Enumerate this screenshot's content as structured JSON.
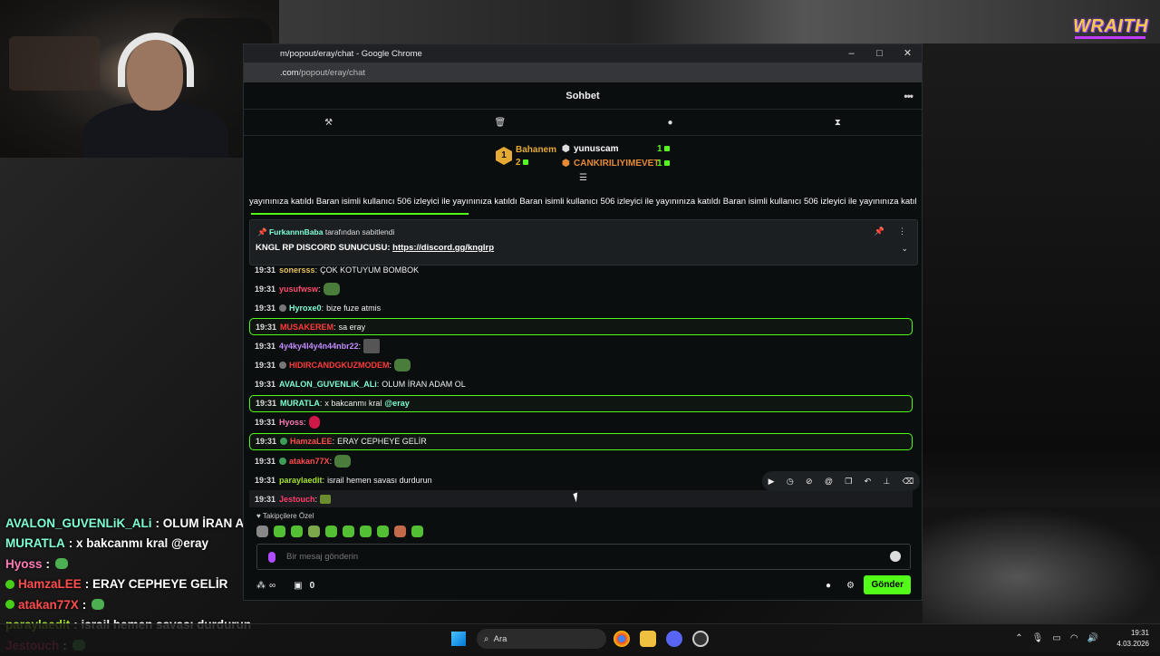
{
  "brand": "WRAITH",
  "overlay_chat": [
    {
      "user": "AVALON_GUVENLiK_ALi",
      "text": ": OLUM İRAN ADAM OL",
      "color": "#7fffd4",
      "badge": false,
      "emote": false
    },
    {
      "user": "MURATLA",
      "text": ": x bakcanmı kral @eray",
      "color": "#7fffd4",
      "badge": false,
      "emote": false
    },
    {
      "user": "Hyoss",
      "text": ":",
      "color": "#ff7ab6",
      "badge": false,
      "emote": true
    },
    {
      "user": "HamzaLEE",
      "text": ": ERAY CEPHEYE GELİR",
      "color": "#ff4d4d",
      "badge": true,
      "emote": false
    },
    {
      "user": "atakan77X",
      "text": ":",
      "color": "#ff4d4d",
      "badge": true,
      "emote": true
    },
    {
      "user": "paraylaedit",
      "text": ": israil hemen savası durdurun",
      "color": "#a6e22e",
      "badge": false,
      "emote": false
    },
    {
      "user": "Jestouch",
      "text": ":",
      "color": "#ff3b6b",
      "badge": false,
      "emote": true
    }
  ],
  "window": {
    "title": "m/popout/eray/chat - Google Chrome",
    "url_host": ".com",
    "url_path": "/popout/eray/chat"
  },
  "chat": {
    "title": "Sohbet",
    "leaderboard": {
      "first": {
        "name": "Bahanem",
        "rank": "1",
        "count": "2"
      },
      "second": {
        "name": "yunuscam",
        "count": "1"
      },
      "third": {
        "name": "CANKIRILIYIMEVET",
        "count": "1"
      }
    },
    "ticker": "yayınınıza katıldı   Baran isimli kullanıcı 506 izleyici ile yayınınıza katıldı   Baran isimli kullanıcı 506 izleyici ile yayınınıza katıldı   Baran isimli kullanıcı 506 izleyici ile yayınınıza katıl",
    "pinned": {
      "by_user": "FurkannnBaba",
      "by_text": "tarafından sabitlendi",
      "prefix": "KNGL RP DISCORD SUNUCUSU: ",
      "link": "https://discord.gg/knglrp"
    },
    "messages": [
      {
        "time": "19:31",
        "user": "sonersss",
        "color": "#e6c15a",
        "text": "ÇOK KÖTÜYÜM BOMBOK",
        "hl": false
      },
      {
        "time": "19:31",
        "user": "yusufwsw",
        "color": "#ff4d6d",
        "text": "",
        "emote": "em",
        "hl": false
      },
      {
        "time": "19:31",
        "user": "Hyroxe0",
        "color": "#7fffd4",
        "text": "bize fuze atmis",
        "badge": "g",
        "hl": false
      },
      {
        "time": "19:31",
        "user": "MUSAKEREM",
        "color": "#ff3b3b",
        "text": "sa eray",
        "hl": true
      },
      {
        "time": "19:31",
        "user": "4y4ky4l4y4n44nbr22",
        "color": "#c28cff",
        "text": "",
        "emote": "img",
        "hl": false
      },
      {
        "time": "19:31",
        "user": "HIDIRCANDGKUZMODEM",
        "color": "#ff3b3b",
        "text": "",
        "emote": "em",
        "badge": "g",
        "hl": false
      },
      {
        "time": "19:31",
        "user": "AVALON_GUVENLiK_ALi",
        "color": "#7fffd4",
        "text": "OLUM İRAN ADAM OL",
        "hl": false
      },
      {
        "time": "19:31",
        "user": "MURATLA",
        "color": "#7fffd4",
        "text": "x bakcanmı kral",
        "mention": "@eray",
        "hl": true
      },
      {
        "time": "19:31",
        "user": "Hyoss",
        "color": "#ff7ab6",
        "text": "",
        "emote": "red",
        "hl": false
      },
      {
        "time": "19:31",
        "user": "HamzaLEE",
        "color": "#ff4d4d",
        "text": "ERAY CEPHEYE GELİR",
        "badge": "c",
        "hl": true
      },
      {
        "time": "19:31",
        "user": "atakan77X",
        "color": "#ff4d4d",
        "text": "",
        "emote": "em",
        "badge": "c",
        "hl": false
      },
      {
        "time": "19:31",
        "user": "paraylaedit",
        "color": "#a6e22e",
        "text": "israil hemen savası durdurun",
        "hl": false
      },
      {
        "time": "19:31",
        "user": "Jestouch",
        "color": "#ff3b6b",
        "text": "",
        "emote": "box",
        "hl": false,
        "hover": true
      }
    ],
    "followers_only": "Takipçilere Özel",
    "input_placeholder": "Bir mesaj gönderin",
    "viewers_label": "∞",
    "chest_count": "0",
    "send_label": "Gönder"
  },
  "taskbar": {
    "search_label": "Ara",
    "time": "19:31",
    "date": "4.03.2026"
  }
}
